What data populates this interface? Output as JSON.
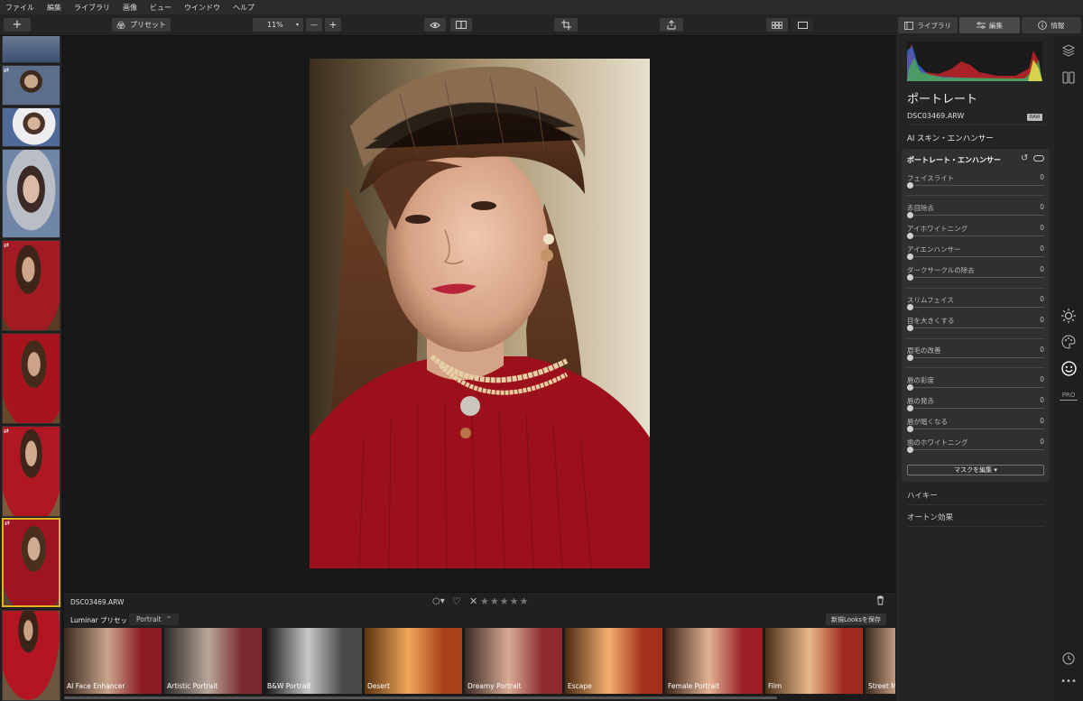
{
  "menu": [
    "ファイル",
    "編集",
    "ライブラリ",
    "画像",
    "ビュー",
    "ウインドウ",
    "ヘルプ"
  ],
  "toolbar": {
    "add": "+",
    "presets": "プリセット",
    "zoom": "11%",
    "zoom_minus": "—",
    "zoom_plus": "+"
  },
  "tabs": {
    "library": "ライブラリ",
    "edit": "編集",
    "info": "情報"
  },
  "panel": {
    "title": "ポートレート",
    "filename": "DSC03469.ARW",
    "raw_badge": "RAW",
    "ai_skin": "AI スキン・エンハンサー",
    "section": "ポートレート・エンハンサー",
    "sliders": [
      {
        "label": "フェイスライト",
        "value": "0"
      },
      {
        "label": "赤目除去",
        "value": "0"
      },
      {
        "label": "アイホワイトニング",
        "value": "0"
      },
      {
        "label": "アイエンハンサー",
        "value": "0"
      },
      {
        "label": "ダークサークルの除去",
        "value": "0"
      },
      {
        "label": "スリムフェイス",
        "value": "0"
      },
      {
        "label": "目を大きくする",
        "value": "0"
      },
      {
        "label": "眉毛の改善",
        "value": "0"
      },
      {
        "label": "唇の彩度",
        "value": "0"
      },
      {
        "label": "唇の発赤",
        "value": "0"
      },
      {
        "label": "唇が暗くなる",
        "value": "0"
      },
      {
        "label": "歯のホワイトニング",
        "value": "0"
      }
    ],
    "mask_button": "マスクを編集 ▾",
    "high_key": "ハイキー",
    "orton": "オートン効果"
  },
  "info": {
    "filename": "DSC03469.ARW"
  },
  "presetbar": {
    "label": "Luminar プリセット",
    "category": "Portrait",
    "save": "新規Looksを保存"
  },
  "looks": [
    "AI Face Enhancer",
    "Artistic Portrait",
    "B&W Portrait",
    "Desert",
    "Dreamy Portrait",
    "Escape",
    "Female Portrait",
    "Film",
    "Street Ma"
  ],
  "colors": {
    "accent": "#e0b21f",
    "panel": "#242424",
    "bg": "#181818"
  }
}
